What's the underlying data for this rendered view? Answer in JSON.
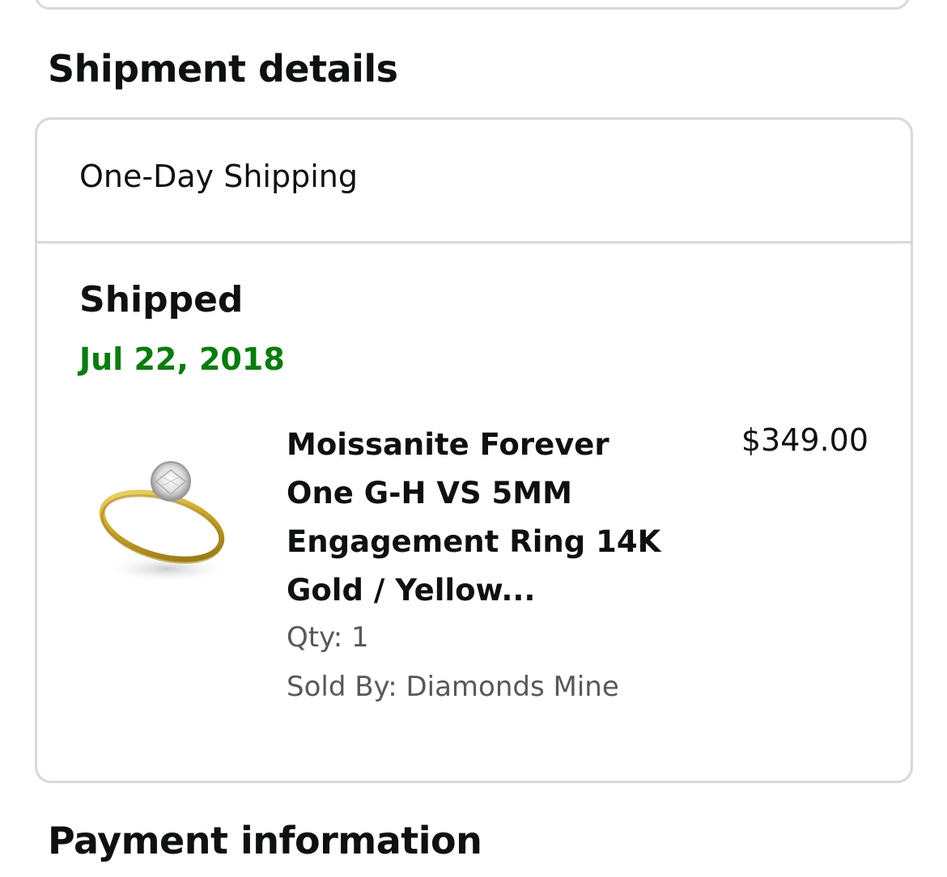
{
  "shipment_section": {
    "heading": "Shipment details",
    "shipping_speed": "One-Day Shipping",
    "status": "Shipped",
    "status_date": "Jul 22, 2018",
    "status_date_color": "#067d0c",
    "item": {
      "image_icon": "ring-product-image",
      "title": "Moissanite Forever One G-H VS 5MM Engagement Ring 14K Gold / Yellow...",
      "price": "$349.00",
      "quantity": "Qty: 1",
      "sold_by": "Sold By: Diamonds Mine"
    }
  },
  "payment_section": {
    "heading": "Payment information"
  }
}
